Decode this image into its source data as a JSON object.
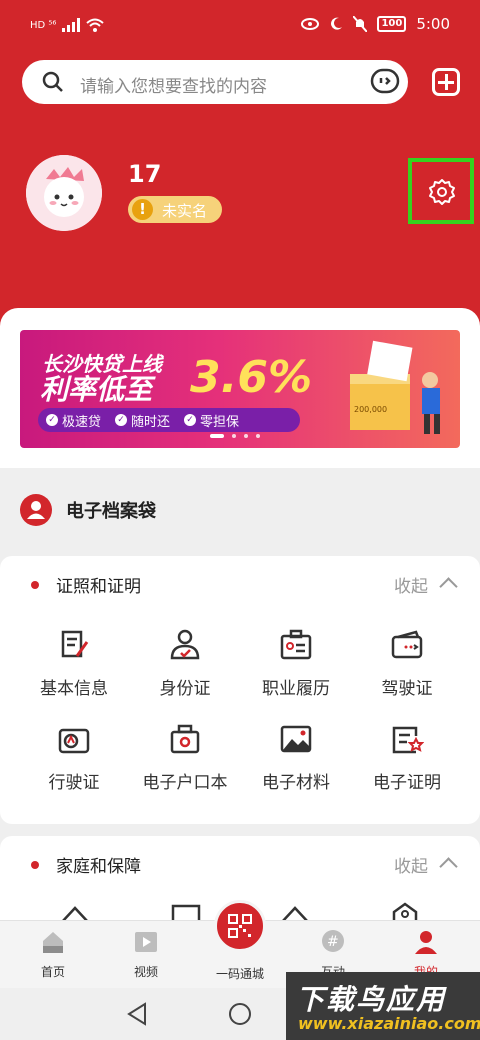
{
  "status_bar": {
    "left_text": "HD ⁵⁶",
    "battery": "100",
    "time": "5:00"
  },
  "search": {
    "placeholder": "请输入您想要查找的内容"
  },
  "profile": {
    "name": "17",
    "badge": "未实名"
  },
  "banner": {
    "line1": "长沙快贷上线",
    "line2": "利率低至",
    "rate": "3.6%",
    "tags": [
      "极速贷",
      "随时还",
      "零担保"
    ],
    "amount": "200,000"
  },
  "archive": {
    "title": "电子档案袋"
  },
  "section1": {
    "title": "证照和证明",
    "collapse": "收起",
    "items": [
      "基本信息",
      "身份证",
      "职业履历",
      "驾驶证",
      "行驶证",
      "电子户口本",
      "电子材料",
      "电子证明"
    ]
  },
  "section2": {
    "title": "家庭和保障",
    "collapse": "收起"
  },
  "tabs": [
    "首页",
    "视频",
    "一码通城",
    "互动",
    "我的"
  ],
  "watermark": {
    "line1": "下载鸟应用",
    "line2": "www.xiazainiao.com"
  },
  "colors": {
    "primary": "#d2262b",
    "highlight": "#36d21e"
  }
}
